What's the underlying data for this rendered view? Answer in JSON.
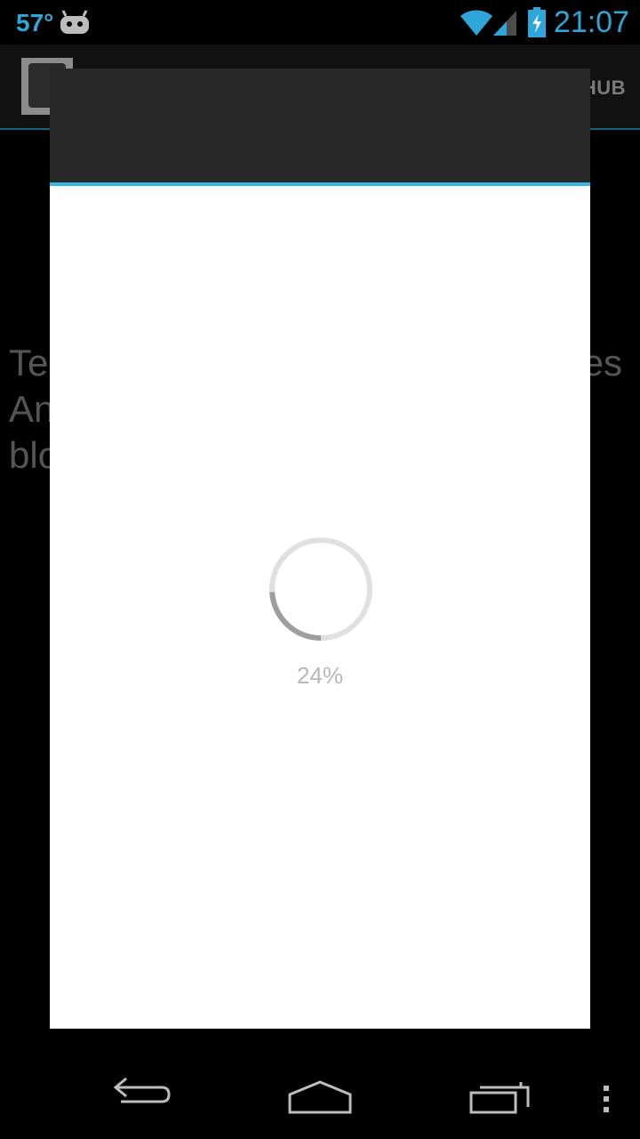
{
  "status_bar": {
    "temperature": "57°",
    "time": "21:07",
    "icons": [
      "android-icon",
      "wifi-icon",
      "signal-icon",
      "battery-charging-icon"
    ]
  },
  "action_bar": {
    "title_fragment": "HUB"
  },
  "background_text": {
    "line1_left": "Te",
    "line1_right": "es",
    "line2_left": "An",
    "line3_left": "blo"
  },
  "dialog": {
    "header_title": "",
    "progress": {
      "value_percent": 24,
      "label": "24%"
    }
  },
  "nav_bar": {
    "icons": [
      "back-icon",
      "home-icon",
      "recent-apps-icon",
      "overflow-menu-icon"
    ]
  },
  "colors": {
    "accent": "#33b5e5",
    "status_text": "#2fa6d9",
    "dialog_header": "#282828",
    "spinner": "#9e9e9e"
  }
}
